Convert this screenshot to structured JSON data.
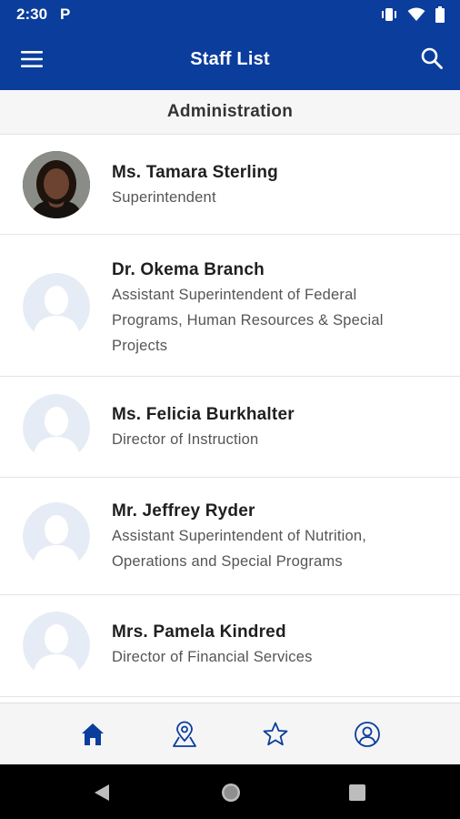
{
  "status_bar": {
    "time": "2:30",
    "notification_icon": "P"
  },
  "app_bar": {
    "title": "Staff List"
  },
  "section": {
    "title": "Administration"
  },
  "staff": [
    {
      "name": "Ms. Tamara Sterling",
      "title": "Superintendent",
      "has_photo": true
    },
    {
      "name": "Dr. Okema Branch",
      "title": "Assistant Superintendent of Federal Programs, Human Resources & Special Projects",
      "has_photo": false
    },
    {
      "name": "Ms. Felicia Burkhalter",
      "title": "Director of Instruction",
      "has_photo": false
    },
    {
      "name": "Mr. Jeffrey Ryder",
      "title": "Assistant Superintendent of Nutrition, Operations and Special Programs",
      "has_photo": false
    },
    {
      "name": "Mrs. Pamela Kindred",
      "title": "Director of Financial Services",
      "has_photo": false
    }
  ],
  "bottom_nav": [
    {
      "icon": "home-icon",
      "active": true
    },
    {
      "icon": "map-pin-icon",
      "active": false
    },
    {
      "icon": "star-icon",
      "active": false
    },
    {
      "icon": "user-icon",
      "active": false
    }
  ],
  "colors": {
    "primary": "#0a3d9c",
    "placeholder_avatar": "#e6ecf5",
    "placeholder_figure": "#ffffff"
  }
}
